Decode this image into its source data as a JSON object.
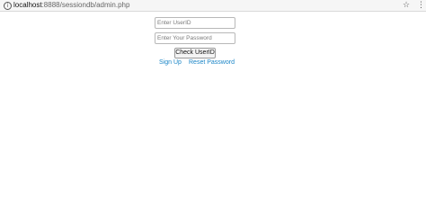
{
  "browser": {
    "url_host": "localhost",
    "url_path": ":8888/sessiondb/admin.php",
    "info_icon": "info-icon",
    "bookmark_icon": "star-icon",
    "menu_icon": "kebab-menu-icon"
  },
  "form": {
    "userid_placeholder": "Enter UserID",
    "password_placeholder": "Enter Your Password",
    "check_button_label": "Check UserID",
    "signup_label": "Sign Up",
    "reset_label": "Reset Password"
  },
  "colors": {
    "link": "#1a85c7",
    "toolbar_bg": "#f6f6f6"
  }
}
